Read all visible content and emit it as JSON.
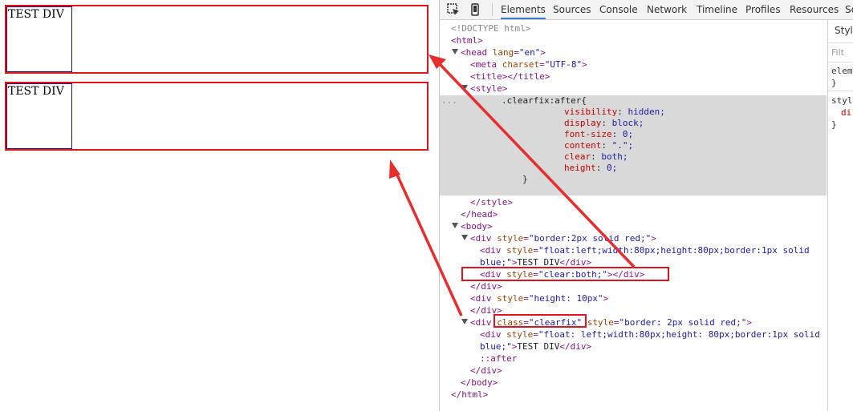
{
  "render": {
    "box1_text": "TEST DIV",
    "box2_text": "TEST DIV"
  },
  "devtools": {
    "tabs": [
      "Elements",
      "Sources",
      "Console",
      "Network",
      "Timeline",
      "Profiles",
      "Resources",
      "Se"
    ],
    "active_tab": "Elements",
    "icons": [
      "inspect-icon",
      "device-mode-icon"
    ],
    "sidebar": {
      "tab": "Style",
      "filter": "Filt",
      "lines": [
        "eleme",
        "}",
        "style",
        "di",
        "}"
      ]
    }
  },
  "dom_tree": {
    "doctype": "<!DOCTYPE html>",
    "html_open": "html",
    "head_open": "head",
    "head_lang_attr": "lang",
    "head_lang_val": "\"en\"",
    "meta_tag": "meta",
    "meta_attr": "charset",
    "meta_val": "\"UTF-8\"",
    "title_tag": "title",
    "style_tag": "style",
    "dots": "...",
    "selector": ".clearfix:after{",
    "css_props": [
      {
        "prop": "visibility",
        "val": "hidden;"
      },
      {
        "prop": "display",
        "val": "block;"
      },
      {
        "prop": "font-size",
        "val": "0;"
      },
      {
        "prop": "content",
        "val": "\".\";"
      },
      {
        "prop": "clear",
        "val": "both;"
      },
      {
        "prop": "height",
        "val": "0;"
      }
    ],
    "close_brace": "}",
    "style_close": "style",
    "head_close": "head",
    "body_open": "body",
    "div_tag": "div",
    "style_attr": "style",
    "div1_style": "\"border:2px solid red;\"",
    "float_div_style_1a": "\"float:left;width:80px;height:80px;border:1px solid",
    "float_div_style_1b": "blue;\"",
    "test_div_text": "TEST DIV",
    "clear_div_style": "\"clear:both;\"",
    "height_div_style": "\"height: 10px\"",
    "class_attr": "class",
    "clearfix_val": "\"clearfix\"",
    "div2_style": "\"border: 2px solid red;\"",
    "float_div_style_2a": "\"float: left;width:80px;height: 80px;border:1px solid",
    "float_div_style_2b": "blue;\"",
    "after_pseudo": "::after",
    "body_close": "body",
    "html_close": "html"
  }
}
